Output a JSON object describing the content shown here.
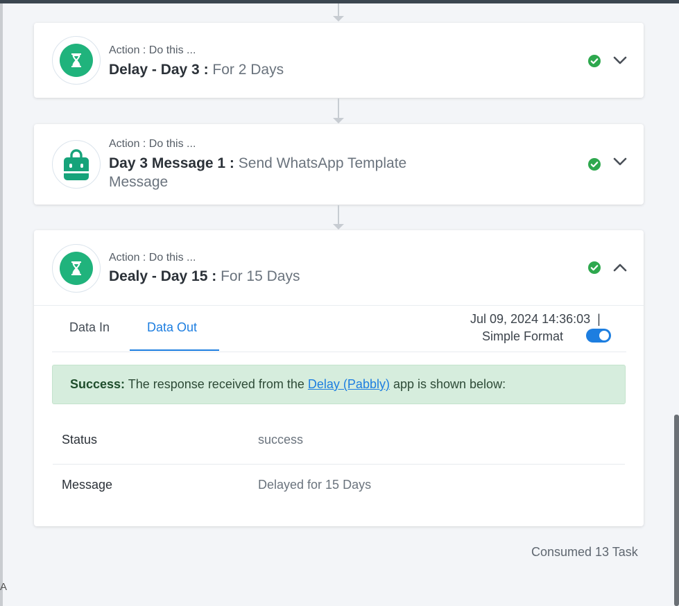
{
  "steps": [
    {
      "action_label": "Action : Do this ...",
      "title": "Delay - Day 3 :",
      "subtitle": "For 2 Days",
      "icon": "hourglass-icon",
      "status": "success",
      "expanded": false
    },
    {
      "action_label": "Action : Do this ...",
      "title": "Day 3 Message 1 :",
      "subtitle": "Send WhatsApp Template Message",
      "icon": "shopping-bag-icon",
      "status": "success",
      "expanded": false
    },
    {
      "action_label": "Action : Do this ...",
      "title": "Dealy - Day 15 :",
      "subtitle": "For 15 Days",
      "icon": "hourglass-icon",
      "status": "success",
      "expanded": true,
      "tabs": [
        "Data In",
        "Data Out"
      ],
      "active_tab": "Data Out",
      "timestamp": "Jul 09, 2024 14:36:03",
      "timestamp_separator": "|",
      "simple_format_label": "Simple Format",
      "simple_format_on": true,
      "alert": {
        "strong": "Success:",
        "text_before": "The response received from the",
        "link": "Delay (Pabbly)",
        "text_after": "app is shown below:"
      },
      "rows": [
        {
          "label": "Status",
          "value": "success"
        },
        {
          "label": "Message",
          "value": "Delayed for 15 Days"
        }
      ]
    }
  ],
  "footer": {
    "consumed": "Consumed 13 Task"
  },
  "colors": {
    "accent": "#1d7ee0",
    "success_green": "#20b37c",
    "check_green": "#2ea84e",
    "alert_bg": "#d6eddd"
  }
}
